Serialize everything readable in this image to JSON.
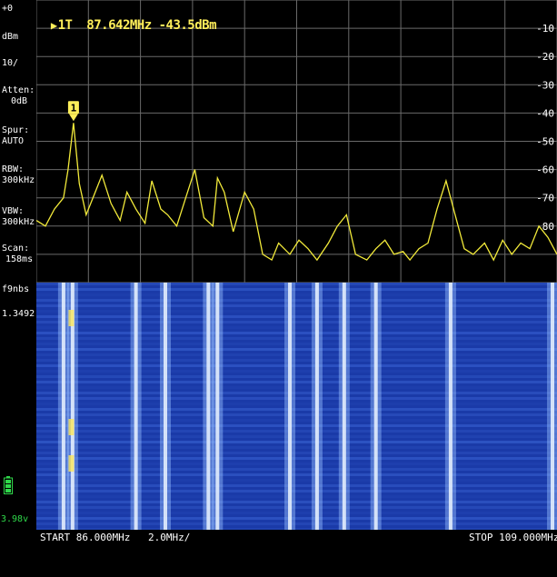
{
  "marker_readout": {
    "symbol": "▶",
    "text": "1T  87.642MHz -43.5dBm"
  },
  "side_panel": {
    "ref_level": "+0",
    "ref_unit": "dBm",
    "scale": "10/",
    "atten_label": "Atten:",
    "atten_value": "0dB",
    "spur_label": "Spur:",
    "spur_value": "AUTO",
    "rbw_label": "RBW:",
    "rbw_value": "300kHz",
    "vbw_label": "VBW:",
    "vbw_value": "300kHz",
    "scan_label": "Scan:",
    "scan_value": "158ms",
    "mode_label": "f9nbs",
    "mode_value": "1.3492",
    "battery_voltage": "3.98v"
  },
  "marker_flag": "1",
  "status_bar": {
    "start": "START 86.000MHz",
    "div": "2.0MHz/",
    "stop": "STOP 109.000MHz"
  },
  "colors": {
    "trace": "#f2ea3a",
    "marker": "#ffef5a",
    "grid": "#6a6a6a",
    "waterfall_base": "#1a3aa8",
    "battery": "#2fd84a"
  },
  "chart_data": {
    "type": "line",
    "title": "",
    "xlabel": "",
    "ylabel": "",
    "xlim": [
      86.0,
      109.0
    ],
    "ylim": [
      -100,
      0
    ],
    "y_ticks": [
      {
        "value": -10,
        "label": "-10"
      },
      {
        "value": -20,
        "label": "-20"
      },
      {
        "value": -30,
        "label": "-30"
      },
      {
        "value": -40,
        "label": "-40"
      },
      {
        "value": -50,
        "label": "-50"
      },
      {
        "value": -60,
        "label": "-60"
      },
      {
        "value": -70,
        "label": "-70"
      },
      {
        "value": -80,
        "label": "-80"
      }
    ],
    "grid": true,
    "marker": {
      "x": 87.642,
      "y": -43.5,
      "label": "1"
    },
    "series": [
      {
        "x": [
          86.0,
          86.4,
          86.8,
          87.2,
          87.4,
          87.642,
          87.9,
          88.2,
          88.6,
          88.9,
          89.3,
          89.7,
          90.0,
          90.4,
          90.8,
          91.1,
          91.5,
          91.8,
          92.2,
          92.6,
          93.0,
          93.4,
          93.8,
          94.0,
          94.3,
          94.7,
          95.2,
          95.6,
          96.0,
          96.4,
          96.7,
          97.2,
          97.6,
          98.0,
          98.4,
          98.9,
          99.3,
          99.7,
          100.1,
          100.6,
          101.0,
          101.4,
          101.8,
          102.2,
          102.5,
          102.9,
          103.3,
          103.7,
          104.1,
          104.5,
          104.9,
          105.3,
          105.8,
          106.2,
          106.6,
          107.0,
          107.4,
          107.8,
          108.2,
          108.6,
          109.0
        ],
        "values": [
          -78,
          -80,
          -74,
          -70,
          -60,
          -43.5,
          -65,
          -76,
          -68,
          -62,
          -72,
          -78,
          -68,
          -74,
          -79,
          -64,
          -74,
          -76,
          -80,
          -70,
          -60,
          -77,
          -80,
          -63,
          -68,
          -82,
          -68,
          -74,
          -90,
          -92,
          -86,
          -90,
          -85,
          -88,
          -92,
          -86,
          -80,
          -76,
          -90,
          -92,
          -88,
          -85,
          -90,
          -89,
          -92,
          -88,
          -86,
          -74,
          -64,
          -76,
          -88,
          -90,
          -86,
          -92,
          -85,
          -90,
          -86,
          -88,
          -80,
          -84,
          -90
        ]
      }
    ]
  },
  "waterfall": {
    "bright_columns_mhz": [
      87.2,
      87.6,
      90.4,
      91.7,
      93.6,
      94.0,
      97.2,
      98.4,
      99.6,
      101.0,
      104.3,
      108.8
    ]
  }
}
